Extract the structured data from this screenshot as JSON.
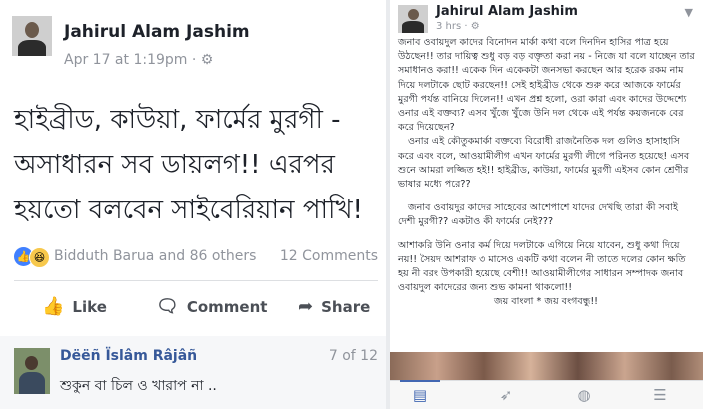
{
  "left_post": {
    "author": "Jahirul Alam Jashim",
    "meta": "Apr 17 at 1:19pm · ⚙",
    "text": "হাইব্রীড, কাউয়া, ফার্মের মুরগী - অসাধারন সব ডায়লগ!! এরপর হয়তো বলবেন সাইবেরিয়ান পাখি!",
    "reactions_names": "Bidduth Barua and 86 others",
    "comments_count": "12 Comments",
    "actions": {
      "like": "Like",
      "comment": "Comment",
      "share": "Share"
    },
    "comment": {
      "author": "Dëëñ Ïslâm Râjâñ",
      "position": "7 of 12",
      "text": "শুকুন বা চিল ও খারাপ না .."
    }
  },
  "right_post": {
    "author": "Jahirul Alam Jashim",
    "meta": "3 hrs · ⚙",
    "paragraphs": [
      "জনাব ওবায়দুল কাদের বিনোদন মার্কা কথা বলে দিনদিন হাসির পাত্র হয়ে উঠছেন!! তার দায়িত্ব শুধু বড় বড় বক্তৃতা করা নয় - নিজে যা বলে যাচ্ছেন তার সমাধানও করা!! একেক দিন একেকটা জনসভা করছেন আর হরেক রকম নাম দিয়ে দলটাকে ছোট করছেন!! সেই হাইব্রীড থেকে শুরু করে আজকে ফার্মের মুরগী পর্যন্ত বানিয়ে দিলেন!! এখন প্রশ্ন হলো, ওরা কারা এবং কাদের উদ্দেশ্যে ওনার এই বক্তব্য? এসব খুঁজে খুঁজে উনি দল থেকে এই পর্যন্ত কয়জনকে বের করে দিয়েছেন?",
      "ওনার এই কৌতুকমার্কা বক্তব্যে বিরোধী রাজনৈতিক দল গুলিও হাসাহাসি করে এবং বলে, আওয়ামীলীগ এখন ফার্মের মুরগী লীগে পরিনত হয়েছে! এসব শুনে আমরা লজ্জিত হই!! হাইব্রীড, কাউয়া, ফার্মের মুরগী এইসব কোন শ্রেণীর ভাষার মধ্যে পরে??",
      "জনাব ওবায়দুর কাদের সাহেবের আশেপাশে যাদের দেখছি তারা কী সবাই দেশী মুরগী?? একটাও কী ফার্মের নেই???",
      "আশাকরি উনি ওনার কর্ম দিয়ে দলটাকে এগিয়ে নিয়ে যাবেন, শুধু কথা দিয়ে নয়!! সৈয়দ আশরাফ ৩ মাসেও একটি কথা বলেন নী তাতে দলের কোন ক্ষতি হয় নী বরং উপকারী হয়েছে বেশী!! আওয়ামীলীগের সাধারন সম্পাদক জনাব ওবায়দুল কাদেরের জন্য শুভ কামনা থাকলো!!",
      "জয় বাংলা * জয় বংগবন্ধু!!"
    ],
    "tabs": [
      {
        "icon": "news-feed-icon",
        "glyph": "▤",
        "active": true
      },
      {
        "icon": "rocket-icon",
        "glyph": "➶",
        "active": false
      },
      {
        "icon": "globe-icon",
        "glyph": "◍",
        "active": false
      },
      {
        "icon": "menu-icon",
        "glyph": "☰",
        "active": false
      }
    ]
  }
}
